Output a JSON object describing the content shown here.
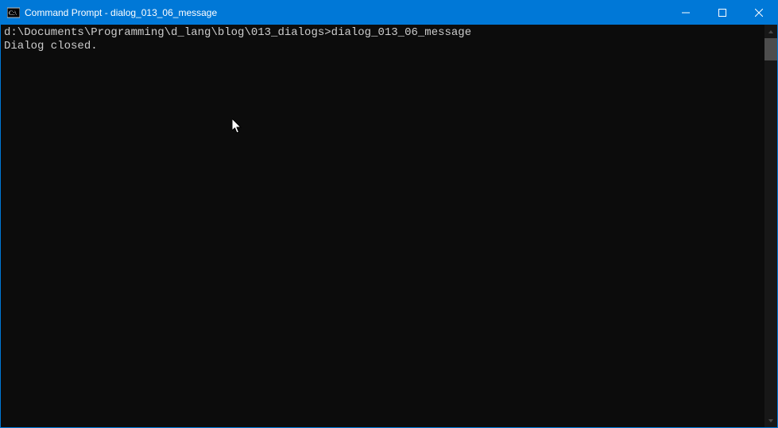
{
  "titlebar": {
    "title": "Command Prompt - dialog_013_06_message"
  },
  "terminal": {
    "prompt_path": "d:\\Documents\\Programming\\d_lang\\blog\\013_dialogs>",
    "command": "dialog_013_06_message",
    "output_line_1": "Dialog closed."
  }
}
